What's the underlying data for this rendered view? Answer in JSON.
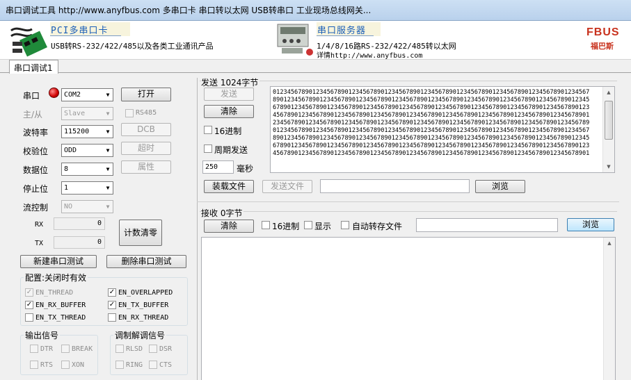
{
  "window": {
    "title": "串口调试工具  http://www.anyfbus.com   多串口卡 串口转以太网 USB转串口 工业现场总线网关..."
  },
  "banner": {
    "pci_title": "PCI多串口卡",
    "pci_desc": "USB转RS-232/422/485以及各类工业通讯产品",
    "server_title": "串口服务器",
    "server_desc1": "1/4/8/16路RS-232/422/485转以太网",
    "server_desc2": "详情http://www.anyfbus.com",
    "logo_text": "FBUS",
    "logo_sub": "福巴斯"
  },
  "tab": {
    "label": "串口调试1"
  },
  "serial": {
    "port_label": "串口",
    "port_value": "COM2",
    "master_label": "主/从",
    "master_value": "Slave",
    "baud_label": "波特率",
    "baud_value": "115200",
    "parity_label": "校验位",
    "parity_value": "ODD",
    "databits_label": "数据位",
    "databits_value": "8",
    "stopbits_label": "停止位",
    "stopbits_value": "1",
    "flow_label": "流控制",
    "flow_value": "NO",
    "open_button": "打开",
    "rs485_label": "RS485",
    "dcb_button": "DCB",
    "timeout_button": "超时",
    "property_button": "属性",
    "rx_label": "RX",
    "rx_value": "0",
    "tx_label": "TX",
    "tx_value": "0",
    "clear_count_button": "计数清零",
    "new_test_button": "新建串口测试",
    "delete_test_button": "删除串口测试"
  },
  "config": {
    "title": "配置:关闭时有效",
    "options": [
      {
        "label": "EN_THREAD",
        "checked": true,
        "disabled": true
      },
      {
        "label": "EN_OVERLAPPED",
        "checked": true,
        "disabled": false
      },
      {
        "label": "EN_RX_BUFFER",
        "checked": true,
        "disabled": false
      },
      {
        "label": "EN_TX_BUFFER",
        "checked": true,
        "disabled": false
      },
      {
        "label": "EN_TX_THREAD",
        "checked": false,
        "disabled": false
      },
      {
        "label": "EN_RX_THREAD",
        "checked": false,
        "disabled": false
      }
    ]
  },
  "output_signals": {
    "title": "输出信号",
    "dtr": "DTR",
    "break": "BREAK",
    "rts": "RTS",
    "xon": "XON"
  },
  "modem_signals": {
    "title": "调制解调信号",
    "rlsd": "RLSD",
    "dsr": "DSR",
    "ring": "RING",
    "cts": "CTS"
  },
  "send": {
    "header": "发送  1024字节",
    "send_button": "发送",
    "clear_button": "清除",
    "hex_label": "16进制",
    "periodic_label": "周期发送",
    "period_value": "250",
    "ms_label": "毫秒",
    "load_file_button": "装载文件",
    "send_file_button": "发送文件",
    "file_path": "",
    "browse_button": "浏览",
    "lines": [
      "0123456789012345678901234567890123456789012345678901234567890123456789012345678901234567",
      "8901234567890123456789012345678901234567890123456789012345678901234567890123456789012345",
      "6789012345678901234567890123456789012345678901234567890123456789012345678901234567890123",
      "4567890123456789012345678901234567890123456789012345678901234567890123456789012345678901",
      "2345678901234567890123456789012345678901234567890123456789012345678901234567890123456789",
      "0123456789012345678901234567890123456789012345678901234567890123456789012345678901234567",
      "8901234567890123456789012345678901234567890123456789012345678901234567890123456789012345",
      "6789012345678901234567890123456789012345678901234567890123456789012345678901234567890123",
      "4567890123456789012345678901234567890123456789012345678901234567890123456789012345678901"
    ]
  },
  "receive": {
    "header": "接收  0字节",
    "clear_button": "清除",
    "hex_label": "16进制",
    "display_label": "显示",
    "autosave_label": "自动转存文件",
    "file_path": "",
    "browse_button": "浏览"
  }
}
